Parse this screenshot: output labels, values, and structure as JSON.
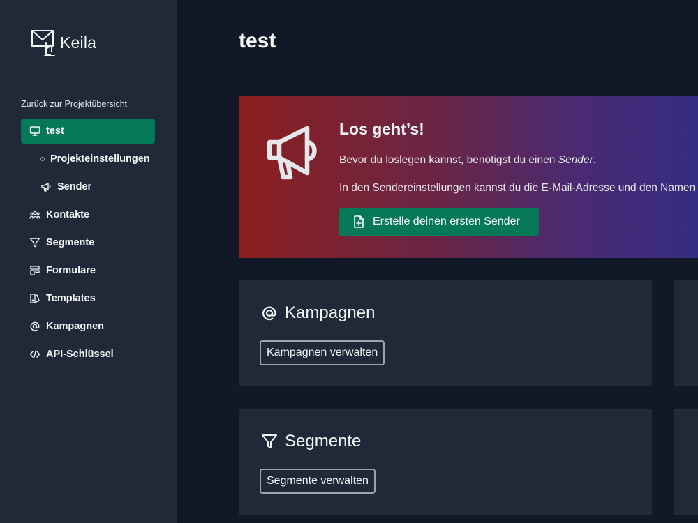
{
  "app": {
    "name": "Keila"
  },
  "sidebar": {
    "back_link": "Zurück zur Projektübersicht",
    "items": [
      {
        "label": "test",
        "icon": "monitor-icon",
        "active": true
      },
      {
        "label": "Projekteinstellungen",
        "icon": "bullet-icon"
      },
      {
        "label": "Sender",
        "icon": "megaphone-icon"
      },
      {
        "label": "Kontakte",
        "icon": "users-icon"
      },
      {
        "label": "Segmente",
        "icon": "filter-icon"
      },
      {
        "label": "Formulare",
        "icon": "form-layout-icon"
      },
      {
        "label": "Templates",
        "icon": "template-icon"
      },
      {
        "label": "Kampagnen",
        "icon": "at-icon"
      },
      {
        "label": "API-Schlüssel",
        "icon": "code-icon"
      }
    ]
  },
  "main": {
    "title": "test",
    "hero": {
      "title": "Los geht’s!",
      "text1_prefix": "Bevor du loslegen kannst, benötigst du einen ",
      "text1_emph": "Sender",
      "text1_suffix": ".",
      "text2": "In den Sendereinstellungen kannst du die E-Mail-Adresse und den Namen festlegen",
      "button_label": "Erstelle deinen ersten Sender"
    },
    "cards": [
      {
        "title": "Kampagnen",
        "icon": "at-icon",
        "button_label": "Kampagnen verwalten"
      },
      {
        "title": "Segmente",
        "icon": "filter-icon",
        "button_label": "Segmente verwalten"
      }
    ]
  },
  "colors": {
    "background": "#111827",
    "sidebar": "#1f2937",
    "accent": "#047857",
    "hero_gradient_start": "#8b1f1f",
    "hero_gradient_end": "#2f2c86"
  }
}
